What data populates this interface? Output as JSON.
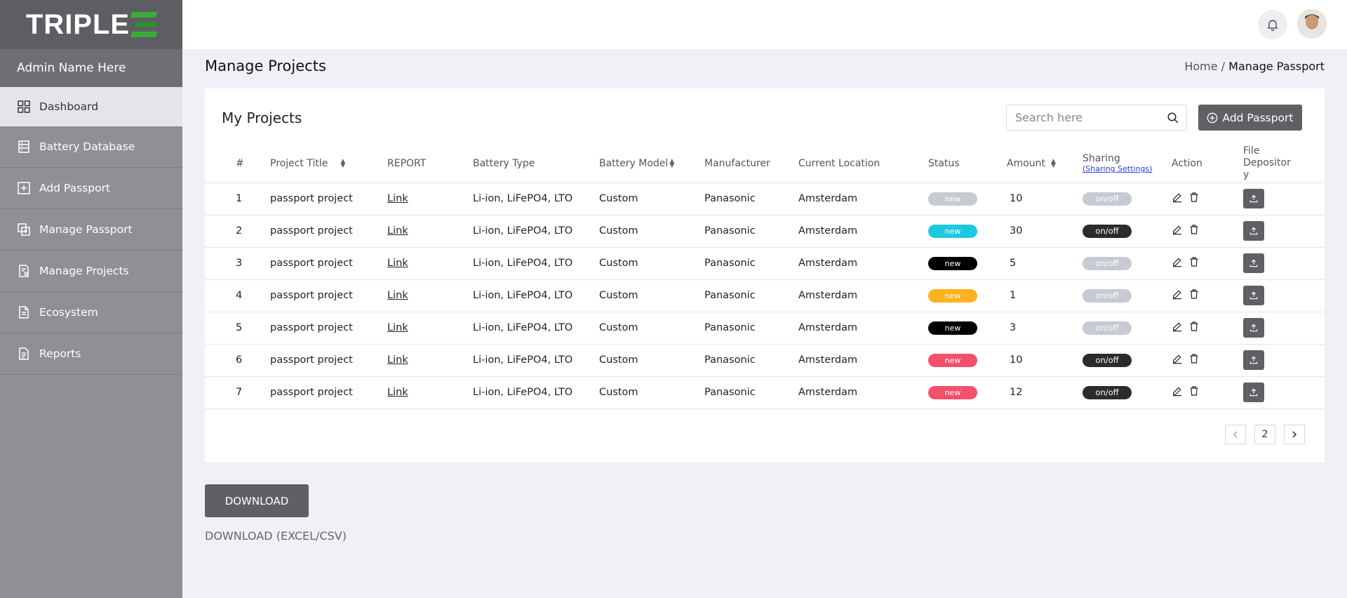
{
  "brand": {
    "logo_text": "TRIPLE"
  },
  "sidebar": {
    "admin_name": "Admin Name Here",
    "items": [
      {
        "label": "Dashboard",
        "icon": "grid-icon",
        "active": true
      },
      {
        "label": "Battery Database",
        "icon": "database-icon"
      },
      {
        "label": "Add Passport",
        "icon": "plus-square-icon"
      },
      {
        "label": "Manage Passport",
        "icon": "copy-icon"
      },
      {
        "label": "Manage Projects",
        "icon": "project-doc-icon"
      },
      {
        "label": "Ecosystem",
        "icon": "document-icon"
      },
      {
        "label": "Reports",
        "icon": "report-icon"
      }
    ]
  },
  "header": {
    "page_title": "Manage Projects",
    "breadcrumb": {
      "home": "Home",
      "separator": "/",
      "current": "Manage Passport"
    }
  },
  "projects": {
    "title": "My Projects",
    "search_placeholder": "Search here",
    "add_label": "Add Passport",
    "columns": {
      "num": "#",
      "project_title": "Project Title",
      "report": "REPORT",
      "battery_type": "Battery Type",
      "battery_model": "Battery Model",
      "manufacturer": "Manufacturer",
      "location": "Current Location",
      "status": "Status",
      "amount": "Amount",
      "sharing": "Sharing",
      "sharing_settings": "(Sharing Settings)",
      "action": "Action",
      "file_depository": "File Depositor y"
    },
    "rows": [
      {
        "num": "1",
        "title": "passport project",
        "report": "Link",
        "type": "Li-ion, LiFePO4, LTO",
        "model": "Custom",
        "manufacturer": "Panasonic",
        "location": "Amsterdam",
        "status": "new",
        "status_color": "#c7c9d3",
        "amount": "10",
        "sharing": "on/off",
        "sharing_on": false
      },
      {
        "num": "2",
        "title": "passport project",
        "report": "Link",
        "type": "Li-ion, LiFePO4, LTO",
        "model": "Custom",
        "manufacturer": "Panasonic",
        "location": "Amsterdam",
        "status": "new",
        "status_color": "#1ec8df",
        "amount": "30",
        "sharing": "on/off",
        "sharing_on": true
      },
      {
        "num": "3",
        "title": "passport project",
        "report": "Link",
        "type": "Li-ion, LiFePO4, LTO",
        "model": "Custom",
        "manufacturer": "Panasonic",
        "location": "Amsterdam",
        "status": "new",
        "status_color": "#000000",
        "amount": "5",
        "sharing": "on/off",
        "sharing_on": false
      },
      {
        "num": "4",
        "title": "passport project",
        "report": "Link",
        "type": "Li-ion, LiFePO4, LTO",
        "model": "Custom",
        "manufacturer": "Panasonic",
        "location": "Amsterdam",
        "status": "new",
        "status_color": "#ffb21f",
        "amount": "1",
        "sharing": "on/off",
        "sharing_on": false
      },
      {
        "num": "5",
        "title": "passport project",
        "report": "Link",
        "type": "Li-ion, LiFePO4, LTO",
        "model": "Custom",
        "manufacturer": "Panasonic",
        "location": "Amsterdam",
        "status": "new",
        "status_color": "#000000",
        "amount": "3",
        "sharing": "on/off",
        "sharing_on": false
      },
      {
        "num": "6",
        "title": "passport project",
        "report": "Link",
        "type": "Li-ion, LiFePO4, LTO",
        "model": "Custom",
        "manufacturer": "Panasonic",
        "location": "Amsterdam",
        "status": "new",
        "status_color": "#f2506b",
        "amount": "10",
        "sharing": "on/off",
        "sharing_on": true
      },
      {
        "num": "7",
        "title": "passport project",
        "report": "Link",
        "type": "Li-ion, LiFePO4, LTO",
        "model": "Custom",
        "manufacturer": "Panasonic",
        "location": "Amsterdam",
        "status": "new",
        "status_color": "#f2506b",
        "amount": "12",
        "sharing": "on/off",
        "sharing_on": true
      }
    ],
    "pagination": {
      "page": "2"
    }
  },
  "download": {
    "button_label": "DOWNLOAD",
    "caption": "DOWNLOAD (EXCEL/CSV)"
  }
}
